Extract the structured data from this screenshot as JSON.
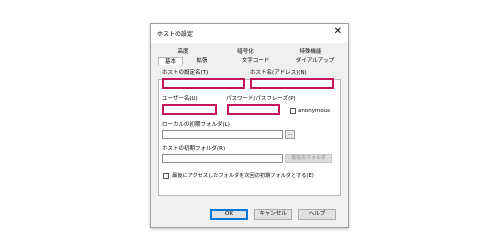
{
  "dialog": {
    "title": "ホストの設定",
    "close_glyph": "✕"
  },
  "tabs": {
    "back_row": [
      "高度",
      "暗号化",
      "特殊機能"
    ],
    "front_row": [
      "基本",
      "拡張",
      "文字コード",
      "ダイアルアップ"
    ],
    "active": "基本"
  },
  "form": {
    "host_setting_name_label": "ホストの設定名(T)",
    "host_name_label": "ホスト名(アドレス)(N)",
    "host_setting_name_value": "",
    "host_name_value": "",
    "username_label": "ユーザー名(U)",
    "password_label": "パスワード/パスフレーズ(P)",
    "username_value": "",
    "password_value": "",
    "anonymous_label": "anonymous",
    "anonymous_checked": false,
    "local_folder_label": "ローカルの初期フォルダ(L)",
    "local_folder_value": "",
    "browse_label": "...",
    "host_folder_label": "ホストの初期フォルダ(R)",
    "host_folder_value": "",
    "current_folder_button": "現在のフォルダ",
    "remember_last_folder_label": "最後にアクセスしたフォルダを次回の初期フォルダとする(E)",
    "remember_last_folder_checked": false
  },
  "buttons": {
    "ok": "OK",
    "cancel": "キャンセル",
    "help": "ヘルプ"
  },
  "colors": {
    "highlight": "#c2185b",
    "default_button_border": "#0078d7"
  }
}
